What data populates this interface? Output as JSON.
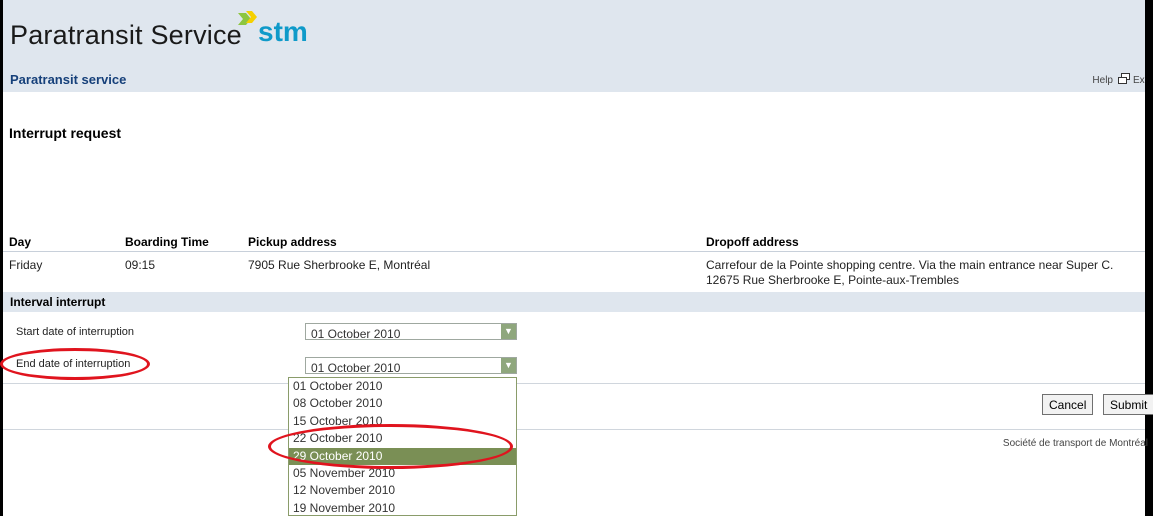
{
  "header": {
    "logo_text": "Paratransit Service",
    "logo_brand": "stm",
    "subtitle": "Paratransit service",
    "help_label": "Help",
    "exit_label": "Ex"
  },
  "page": {
    "title": "Interrupt request"
  },
  "trip_table": {
    "headers": [
      "Day",
      "Boarding Time",
      "Pickup address",
      "Dropoff address"
    ],
    "row": {
      "day": "Friday",
      "boarding_time": "09:15",
      "pickup": "7905 Rue Sherbrooke E, Montréal",
      "dropoff_line1": "Carrefour de la Pointe shopping centre. Via the main entrance near Super C.",
      "dropoff_line2": "12675 Rue Sherbrooke E, Pointe-aux-Trembles"
    }
  },
  "interval": {
    "title": "Interval interrupt",
    "start_label": "Start date of interruption",
    "start_value": "01 October 2010",
    "end_label": "End date of interruption",
    "end_value": "01 October 2010",
    "options": [
      "01 October 2010",
      "08 October 2010",
      "15 October 2010",
      "22 October 2010",
      "29 October 2010",
      "05 November 2010",
      "12 November 2010",
      "19 November 2010"
    ],
    "highlighted_option": "29 October 2010"
  },
  "actions": {
    "cancel_label": "Cancel",
    "submit_label": "Submit"
  },
  "footer": {
    "text": "Société de transport de Montréal"
  },
  "colors": {
    "header_bg": "#dfe6ee",
    "subtitle": "#16407a",
    "brand": "#0f9ac9",
    "selected_option": "#7a8f55",
    "annotation": "#e0141e"
  }
}
